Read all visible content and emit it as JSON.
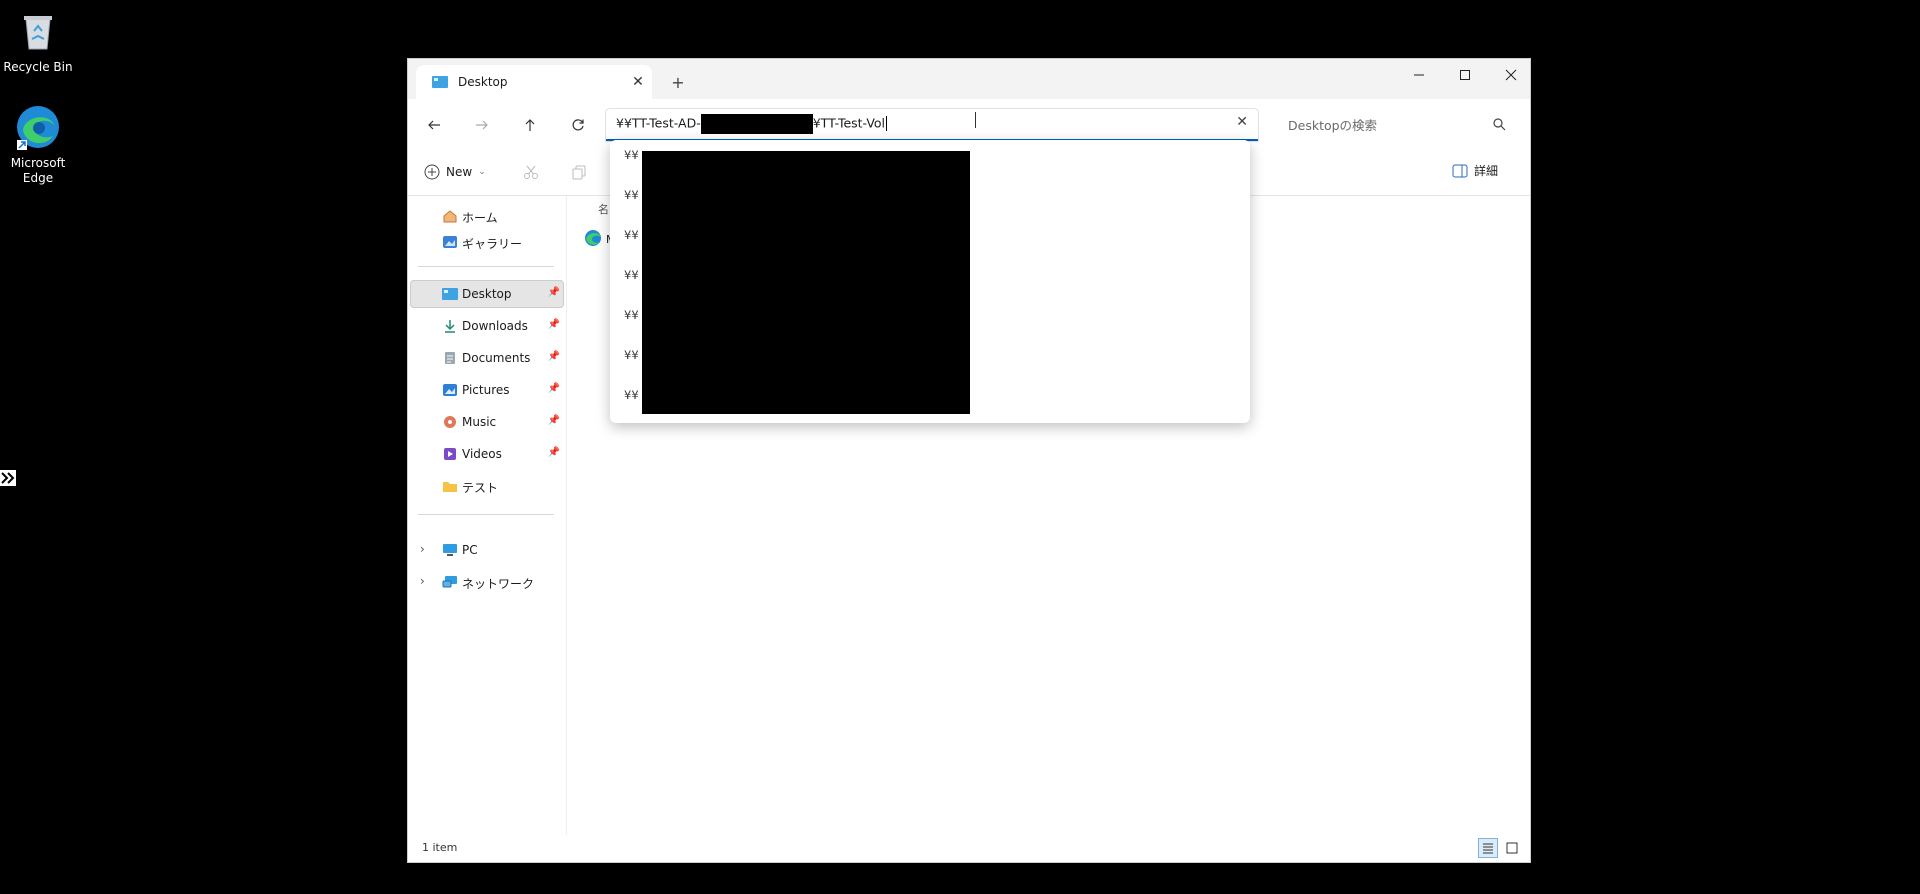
{
  "desktop": {
    "icons": [
      {
        "label": "Recycle Bin",
        "icon": "recycle-bin-icon"
      },
      {
        "label": "Microsoft Edge",
        "icon": "edge-icon"
      }
    ]
  },
  "window": {
    "tab": {
      "label": "Desktop",
      "close": "✕"
    },
    "new_tab": "+",
    "controls": {
      "minimize": "—",
      "maximize": "☐",
      "close": "✕"
    }
  },
  "navigation": {
    "back": "←",
    "forward": "→",
    "up": "↑",
    "refresh": "⟳"
  },
  "address_bar": {
    "value_prefix": "¥¥TT-Test-AD-",
    "value_suffix": "¥TT-Test-Vol",
    "clear": "✕"
  },
  "search": {
    "placeholder": "Desktopの検索"
  },
  "command_bar": {
    "new_label": "New",
    "details_label": "詳細"
  },
  "nav_pane": {
    "items": [
      {
        "label": "ホーム",
        "icon": "home-icon"
      },
      {
        "label": "ギャラリー",
        "icon": "gallery-icon"
      },
      {
        "label": "Desktop",
        "icon": "desktop-icon",
        "pinned": true,
        "selected": true
      },
      {
        "label": "Downloads",
        "icon": "download-icon",
        "pinned": true
      },
      {
        "label": "Documents",
        "icon": "documents-icon",
        "pinned": true
      },
      {
        "label": "Pictures",
        "icon": "pictures-icon",
        "pinned": true
      },
      {
        "label": "Music",
        "icon": "music-icon",
        "pinned": true
      },
      {
        "label": "Videos",
        "icon": "videos-icon",
        "pinned": true
      },
      {
        "label": "テスト",
        "icon": "folder-icon"
      },
      {
        "label": "PC",
        "icon": "pc-icon",
        "expandable": true
      },
      {
        "label": "ネットワーク",
        "icon": "network-icon",
        "expandable": true
      }
    ]
  },
  "content": {
    "column_header": "名",
    "item_initial": "M"
  },
  "dropdown": {
    "prefix": "¥¥",
    "items": [
      "¥¥",
      "¥¥",
      "¥¥",
      "¥¥",
      "¥¥",
      "¥¥",
      "¥¥"
    ]
  },
  "status": {
    "item_count": "1 item"
  },
  "colors": {
    "accent": "#005fb8",
    "annotation": "#e3001b"
  }
}
